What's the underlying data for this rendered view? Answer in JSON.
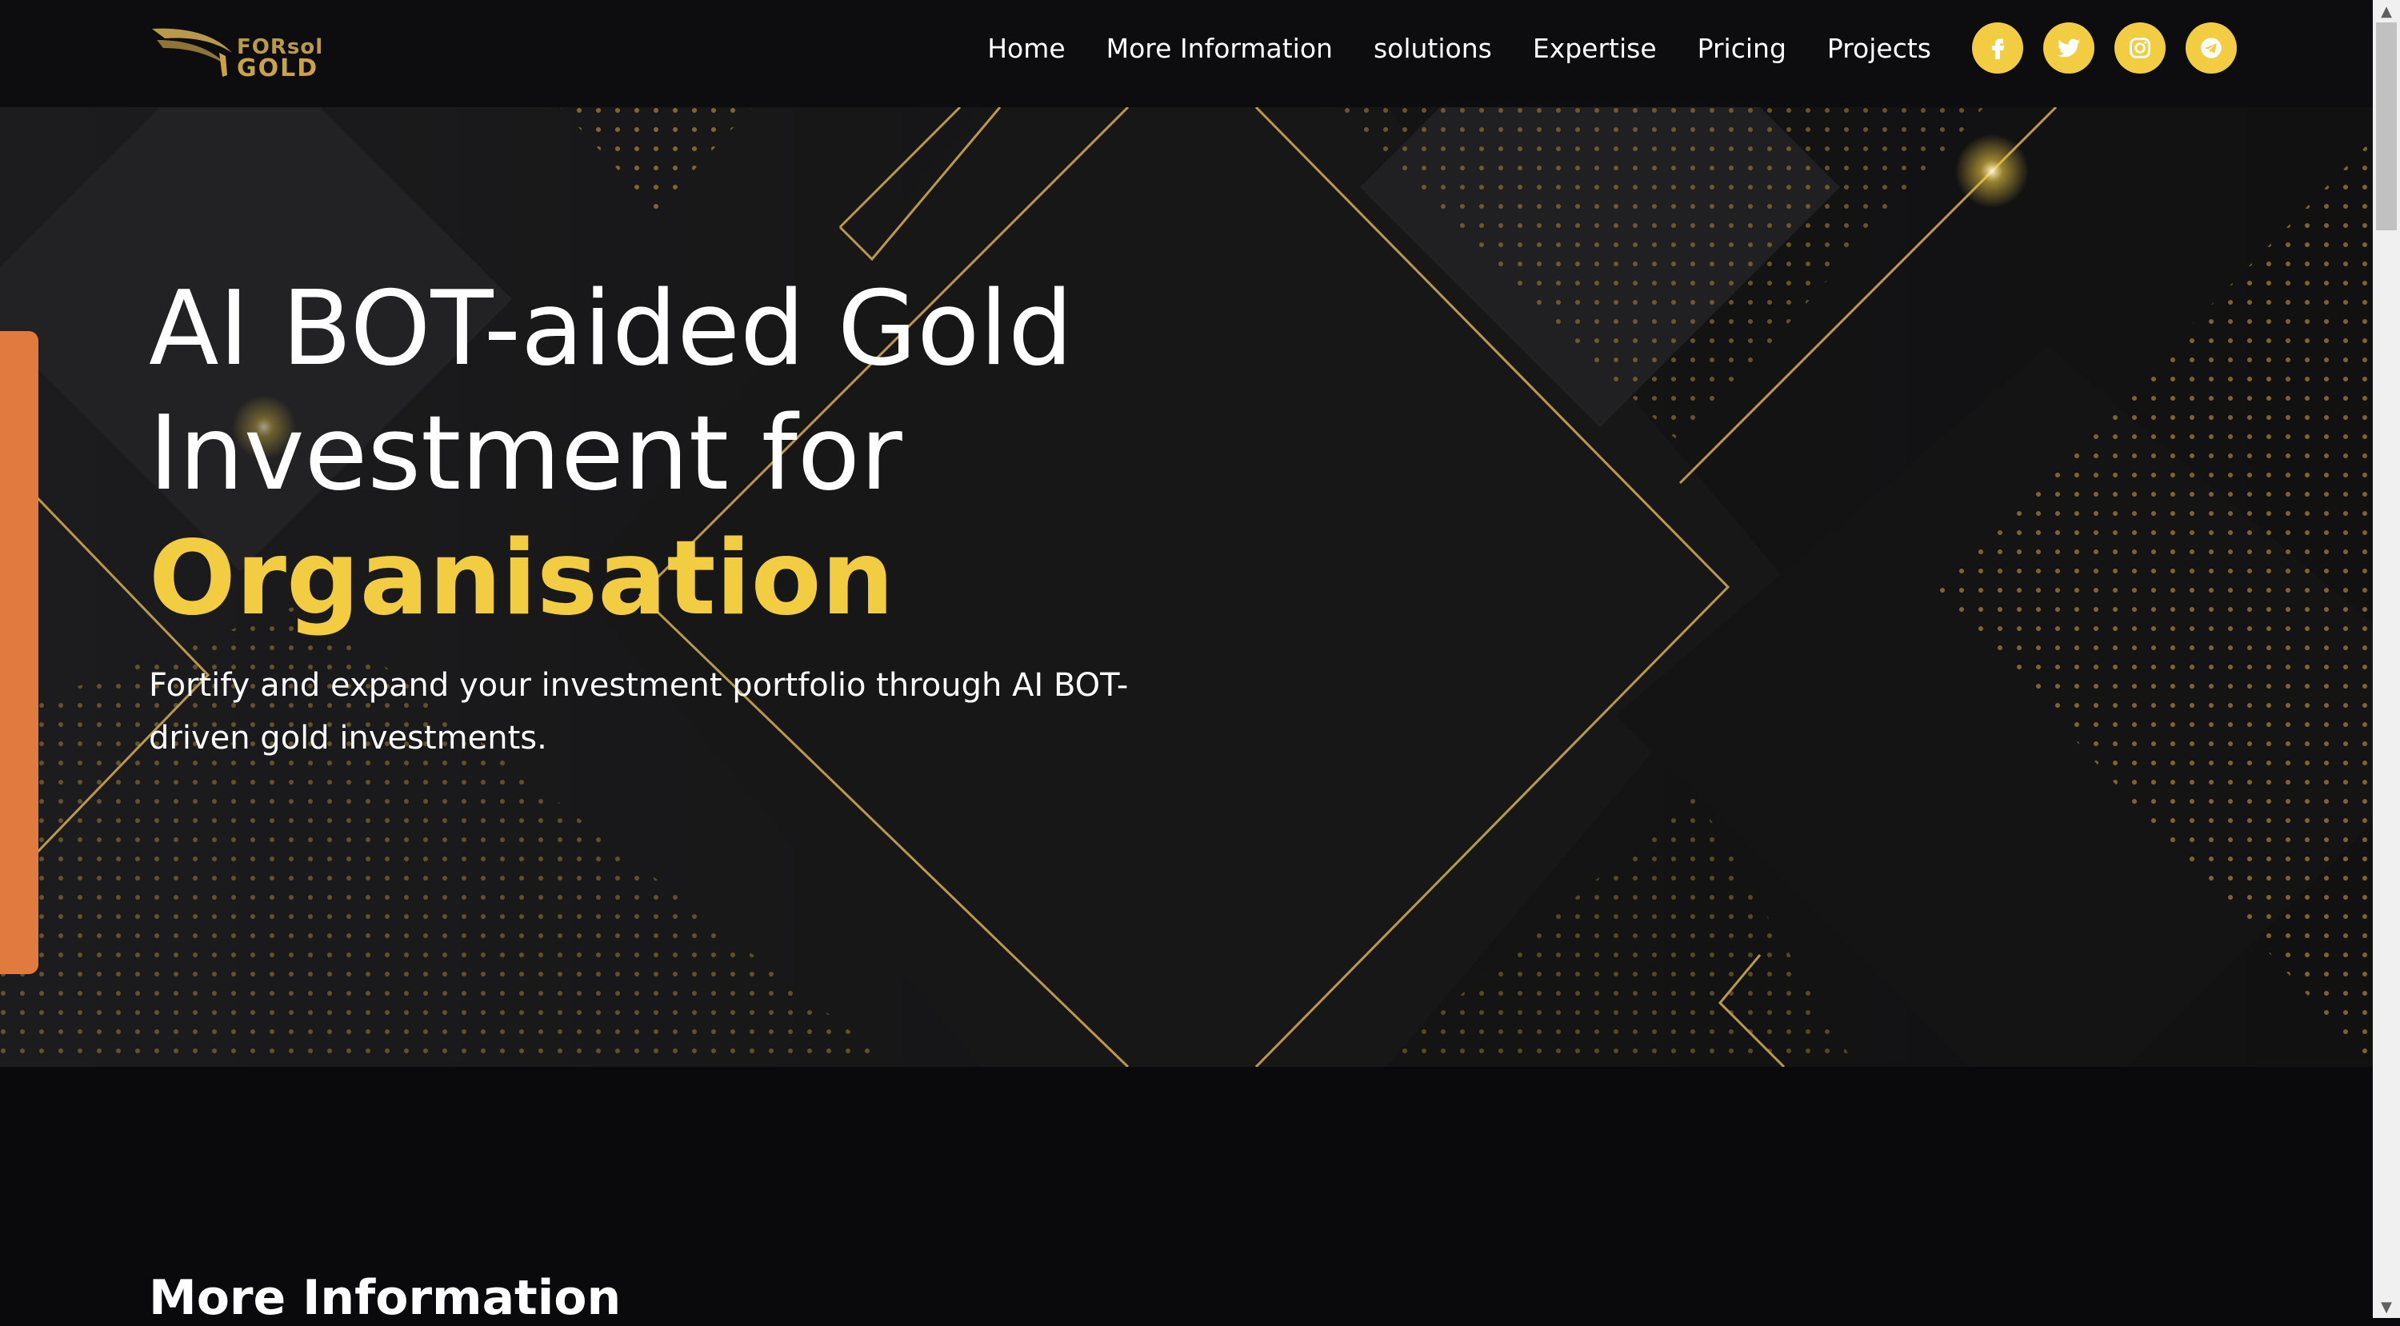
{
  "brand": {
    "top": "FORsol",
    "bottom": "GOLD"
  },
  "nav": {
    "items": [
      {
        "label": "Home"
      },
      {
        "label": "More Information"
      },
      {
        "label": "solutions"
      },
      {
        "label": "Expertise"
      },
      {
        "label": "Pricing"
      },
      {
        "label": "Projects"
      }
    ],
    "social": [
      "facebook-icon",
      "twitter-icon",
      "instagram-icon",
      "telegram-icon"
    ]
  },
  "hero": {
    "title_line1": "AI BOT-aided Gold",
    "title_line2": "Investment for",
    "title_accent": "Organisation",
    "subtitle": "Fortify and expand your investment portfolio through AI BOT-driven gold investments."
  },
  "section": {
    "more_information_title": "More Information"
  },
  "colors": {
    "accent": "#f2cd42",
    "side_tab": "#e07a3e",
    "background": "#0a0a0c",
    "gold_line": "#b99a4a"
  }
}
